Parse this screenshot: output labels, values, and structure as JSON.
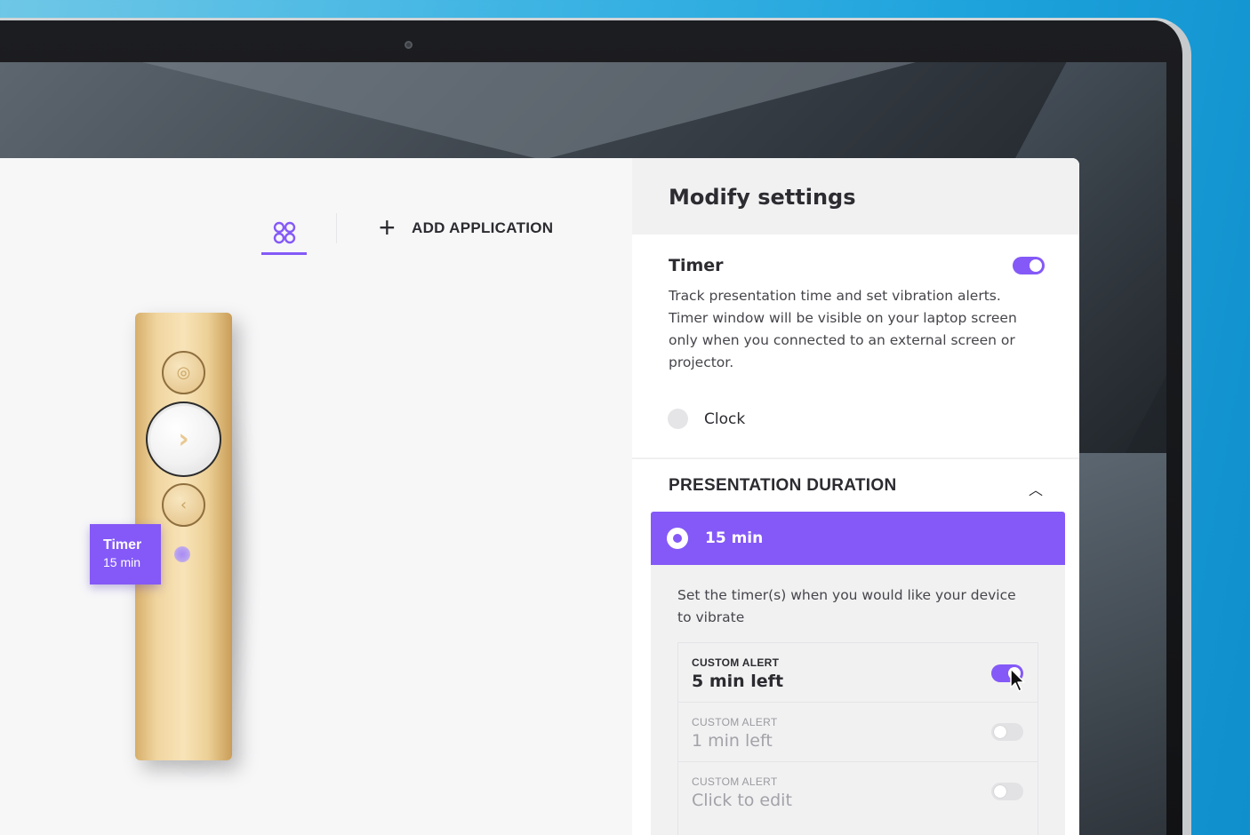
{
  "app": {
    "nav": {
      "add_application_label": "ADD APPLICATION"
    },
    "device_tag": {
      "title": "Timer",
      "subtitle": "15 min"
    }
  },
  "panel": {
    "title": "Modify settings",
    "timer": {
      "label": "Timer",
      "enabled": true,
      "description": "Track presentation time and set vibration alerts. Timer window will be visible on your laptop screen only when you connected to an external screen or projector.",
      "clock_label": "Clock"
    },
    "presentation_duration": {
      "title": "PRESENTATION DURATION",
      "selected_label": "15 min",
      "vibrate_description": "Set the timer(s) when you would like your device to vibrate",
      "alerts": [
        {
          "caption": "CUSTOM ALERT",
          "value": "5 min left",
          "enabled": true
        },
        {
          "caption": "CUSTOM ALERT",
          "value": "1 min left",
          "enabled": false
        },
        {
          "caption": "CUSTOM ALERT",
          "value": "Click to edit",
          "enabled": false
        }
      ]
    }
  },
  "colors": {
    "accent": "#8459f7",
    "device_gold": "#f0d59f",
    "panel_bg": "#ffffff",
    "header_bg": "#f1f1f2"
  },
  "icons": [
    "apps-grid-icon",
    "plus-icon",
    "chevron-up-icon",
    "cursor-arrow-icon",
    "webcam-icon"
  ]
}
